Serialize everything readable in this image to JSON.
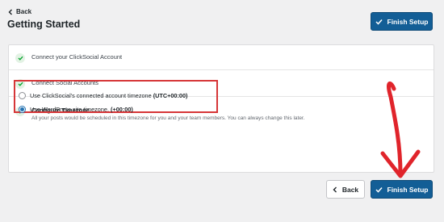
{
  "header": {
    "back_label": "Back",
    "title": "Getting Started",
    "finish_label": "Finish Setup"
  },
  "steps": [
    {
      "label": "Connect your ClickSocial Account",
      "status": "complete",
      "icon": "check-icon"
    },
    {
      "label": "Connect Social Accounts",
      "status": "complete",
      "icon": "check-icon"
    },
    {
      "label": "Configure Timezone",
      "status": "active",
      "icon": "check-icon",
      "description": "All your posts would be scheduled in this timezone for you and your team members. You can always change this later."
    }
  ],
  "timezone_options": [
    {
      "label": "Use ClickSocial's connected account timezone",
      "value": "(UTC+00:00)",
      "selected": false
    },
    {
      "label": "Use WordPress site timezone.",
      "value": "(+00:00)",
      "selected": true
    }
  ],
  "footer": {
    "back_label": "Back",
    "finish_label": "Finish Setup"
  },
  "colors": {
    "primary": "#135e96",
    "highlight": "#d63638",
    "check": "#00a32a"
  }
}
